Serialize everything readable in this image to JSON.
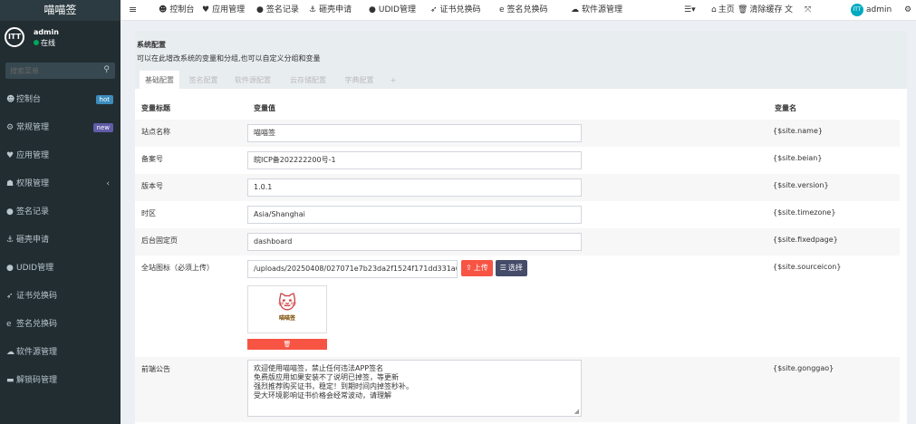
{
  "app": {
    "logo": "喵喵签"
  },
  "user": {
    "avatar_text": "ITT",
    "name": "admin",
    "status": "在线"
  },
  "sidebar": {
    "search_placeholder": "搜索菜单",
    "items": [
      {
        "label": "控制台",
        "icon": "dashboard-icon",
        "glyph": "☻",
        "badge": "hot",
        "badge_color": "#3c8dbc"
      },
      {
        "label": "常规管理",
        "icon": "cogs-icon",
        "glyph": "⚙",
        "badge": "new",
        "badge_color": "#605ca8"
      },
      {
        "label": "应用管理",
        "icon": "heart-icon",
        "glyph": "♥"
      },
      {
        "label": "权限管理",
        "icon": "group-icon",
        "glyph": "☗",
        "arrow": "‹"
      },
      {
        "label": "签名记录",
        "icon": "circle-icon",
        "glyph": "●"
      },
      {
        "label": "砸壳申请",
        "icon": "anchor-icon",
        "glyph": "⚓"
      },
      {
        "label": "UDID管理",
        "icon": "apple-icon",
        "glyph": "●"
      },
      {
        "label": "证书兑换码",
        "icon": "paper-plane-icon",
        "glyph": "➶"
      },
      {
        "label": "签名兑换码",
        "icon": "edge-icon",
        "glyph": "e"
      },
      {
        "label": "软件源管理",
        "icon": "cloud-icon",
        "glyph": "☁"
      },
      {
        "label": "解锁码管理",
        "icon": "id-card-icon",
        "glyph": "▬"
      }
    ]
  },
  "topnav": {
    "menu_icon": "≡",
    "items": [
      {
        "label": "控制台",
        "glyph": "☻"
      },
      {
        "label": "应用管理",
        "glyph": "♥"
      },
      {
        "label": "签名记录",
        "glyph": "●"
      },
      {
        "label": "砸壳申请",
        "glyph": "⚓"
      },
      {
        "label": "UDID管理",
        "glyph": "●"
      },
      {
        "label": "证书兑换码",
        "glyph": "➶"
      },
      {
        "label": "签名兑换码",
        "glyph": "e"
      },
      {
        "label": "软件源管理",
        "glyph": "☁"
      }
    ],
    "right": {
      "list_icon": "☰▾",
      "home": "主页",
      "home_glyph": "⌂",
      "clear_cache": "清除缓存",
      "clear_glyph": "🗑",
      "lang": "文",
      "fullscreen": "⤧",
      "user": "admin",
      "avatar_text": "ITT",
      "gear": "⚙"
    }
  },
  "panel": {
    "title": "系统配置",
    "desc": "可以在此增改系统的变量和分组,也可以自定义分组和变量",
    "tabs": [
      "基础配置",
      "签名配置",
      "软件源配置",
      "云存储配置",
      "字典配置",
      "+"
    ],
    "active_tab": 0
  },
  "table": {
    "headers": [
      "变量标题",
      "变量值",
      "变量名"
    ],
    "rows": [
      {
        "title": "站点名称",
        "value": "喵喵签",
        "var": "{$site.name}"
      },
      {
        "title": "备案号",
        "value": "皖ICP备202222200号-1",
        "var": "{$site.beian}"
      },
      {
        "title": "版本号",
        "value": "1.0.1",
        "var": "{$site.version}"
      },
      {
        "title": "时区",
        "value": "Asia/Shanghai",
        "var": "{$site.timezone}"
      },
      {
        "title": "后台固定页",
        "value": "dashboard",
        "var": "{$site.fixedpage}"
      }
    ],
    "icon_row": {
      "title": "全站图标（必须上传）",
      "value": "/uploads/20250408/027071e7b23da2f1524f171dd331a68c.jpg",
      "upload": "上传",
      "select": "选择",
      "var": "{$site.sourceicon}",
      "thumb_text": "喵喵签"
    },
    "notice_row": {
      "title": "前端公告",
      "lines": [
        "欢迎使用喵喵签，禁止任何违法APP签名",
        "免费版应用如果安装不了说明已掉签，等更新",
        "强烈推荐购买证书，稳定！到期时间内掉签秒补。",
        "受大环境影响证书价格会经常波动，请理解"
      ],
      "var": "{$site.gonggao}"
    }
  },
  "colors": {
    "sidebar": "#222d32",
    "danger": "#f75444",
    "navy": "#444c69",
    "success": "#00a65a"
  }
}
